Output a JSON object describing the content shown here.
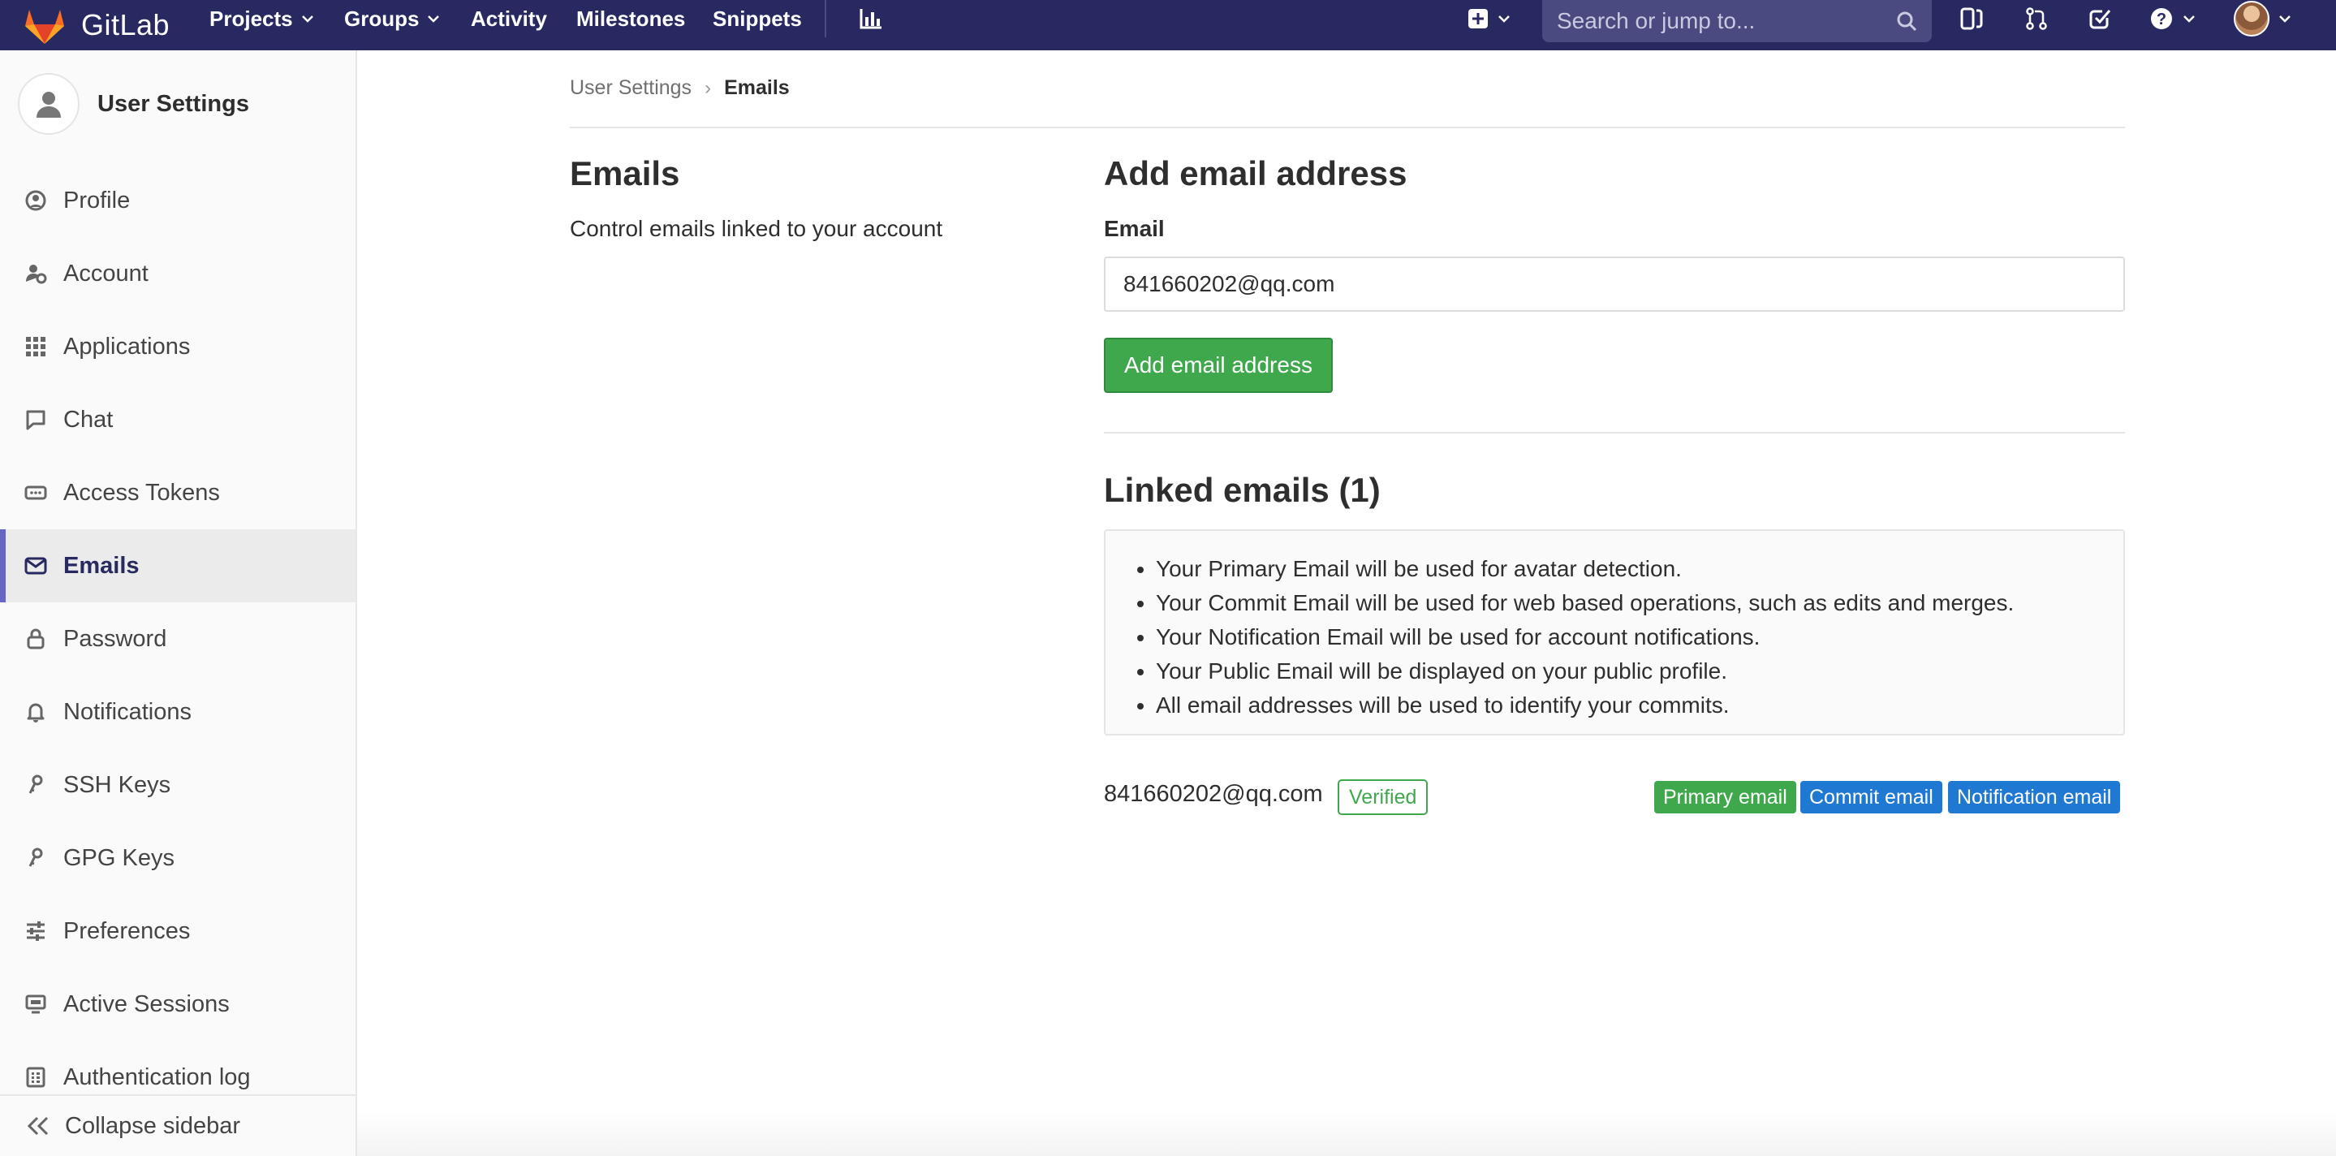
{
  "navbar": {
    "brand": "GitLab",
    "links": [
      {
        "label": "Projects",
        "dropdown": true
      },
      {
        "label": "Groups",
        "dropdown": true
      },
      {
        "label": "Activity",
        "dropdown": false
      },
      {
        "label": "Milestones",
        "dropdown": false
      },
      {
        "label": "Snippets",
        "dropdown": false
      }
    ],
    "search_placeholder": "Search or jump to...",
    "icons": [
      "chart-icon",
      "plus-square-icon",
      "search-icon",
      "issues-icon",
      "merge-request-icon",
      "todo-icon",
      "help-icon",
      "user-avatar"
    ]
  },
  "sidebar": {
    "title": "User Settings",
    "items": [
      {
        "label": "Profile",
        "icon": "profile-icon"
      },
      {
        "label": "Account",
        "icon": "account-icon"
      },
      {
        "label": "Applications",
        "icon": "applications-icon"
      },
      {
        "label": "Chat",
        "icon": "chat-icon"
      },
      {
        "label": "Access Tokens",
        "icon": "token-icon"
      },
      {
        "label": "Emails",
        "icon": "mail-icon",
        "active": true
      },
      {
        "label": "Password",
        "icon": "lock-icon"
      },
      {
        "label": "Notifications",
        "icon": "bell-icon"
      },
      {
        "label": "SSH Keys",
        "icon": "key-icon"
      },
      {
        "label": "GPG Keys",
        "icon": "key-icon"
      },
      {
        "label": "Preferences",
        "icon": "sliders-icon"
      },
      {
        "label": "Active Sessions",
        "icon": "monitor-icon"
      },
      {
        "label": "Authentication log",
        "icon": "log-icon"
      }
    ],
    "collapse_label": "Collapse sidebar"
  },
  "breadcrumb": {
    "parent": "User Settings",
    "separator": "›",
    "current": "Emails"
  },
  "section": {
    "title": "Emails",
    "description": "Control emails linked to your account"
  },
  "add_email": {
    "heading": "Add email address",
    "field_label": "Email",
    "field_value": "841660202@qq.com",
    "button_label": "Add email address"
  },
  "linked": {
    "heading": "Linked emails (1)",
    "info": [
      "Your Primary Email will be used for avatar detection.",
      "Your Commit Email will be used for web based operations, such as edits and merges.",
      "Your Notification Email will be used for account notifications.",
      "Your Public Email will be displayed on your public profile.",
      "All email addresses will be used to identify your commits."
    ],
    "emails": [
      {
        "address": "841660202@qq.com",
        "status": "Verified",
        "badges": [
          "Primary email",
          "Commit email",
          "Notification email"
        ]
      }
    ]
  },
  "colors": {
    "navbar": "#292961",
    "success": "#3fa84d",
    "info": "#1f78d1",
    "active_accent": "#6666c4"
  }
}
